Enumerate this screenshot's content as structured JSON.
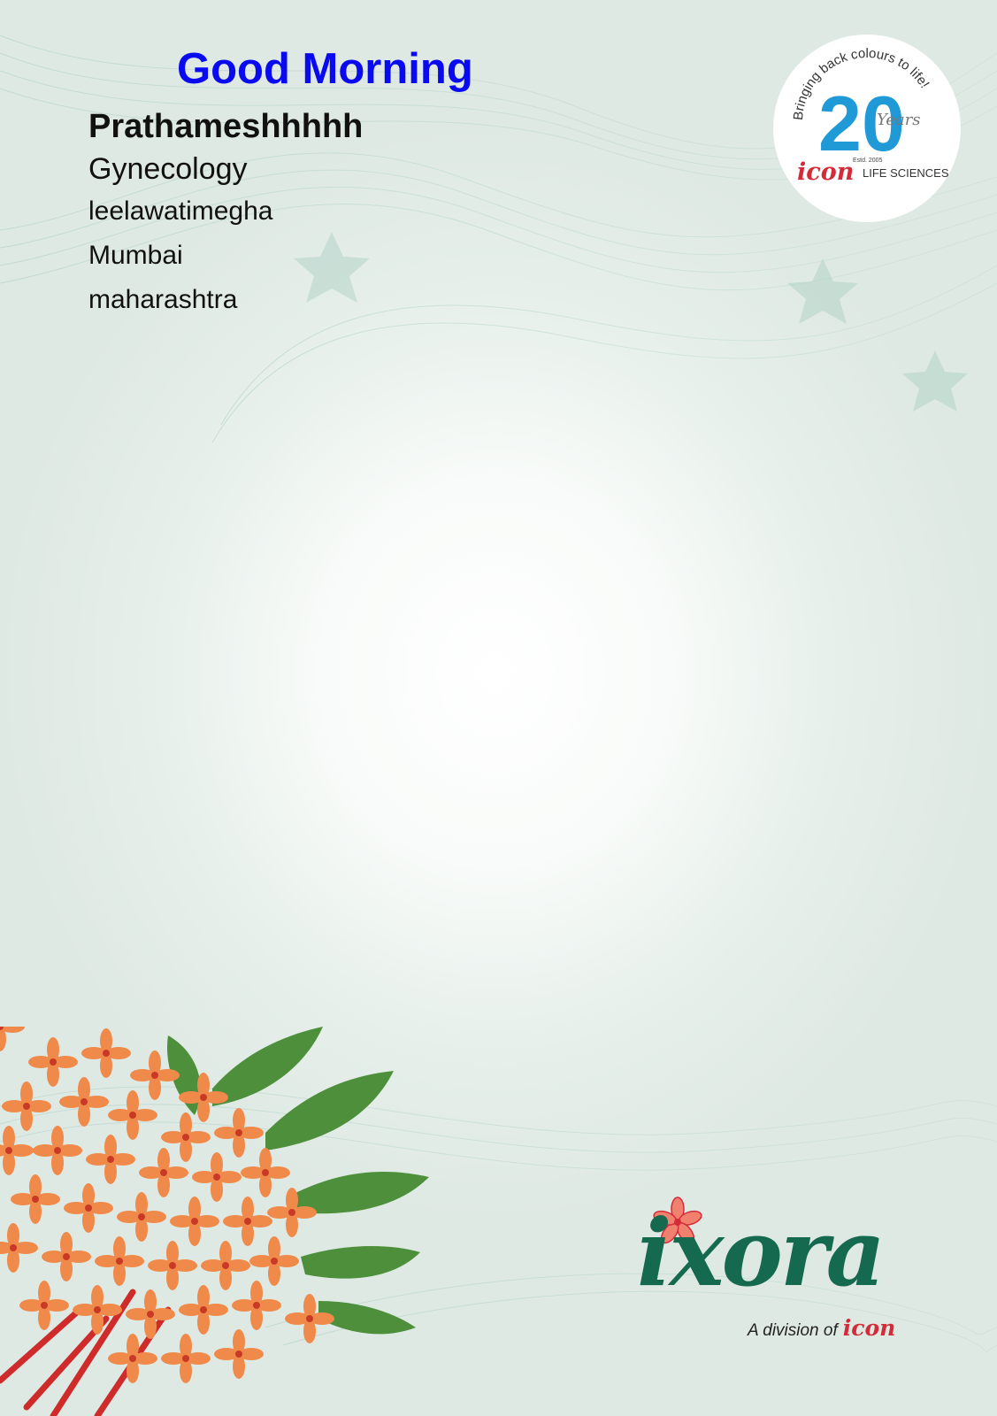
{
  "greeting": "Good Morning",
  "doctor": {
    "name": "Prathameshhhhh",
    "specialty": "Gynecology",
    "clinic": "leelawatimegha",
    "city": "Mumbai",
    "state": "maharashtra"
  },
  "badge": {
    "tagline": "Bringing back colours to life!",
    "number": "20",
    "years": "Years",
    "established": "Estd. 2005",
    "brand": "icon",
    "brand_suffix": "LIFE SCIENCES"
  },
  "brand": {
    "name": "ixora",
    "tagline": "A division of",
    "parent": "icon"
  },
  "colors": {
    "greeting": "#0a0af0",
    "specialty": "#6b6b6b",
    "badge_blue": "#1f9ad6",
    "icon_red": "#d42b39",
    "ixora_green": "#14694f",
    "flower_orange": "#f08a4b"
  }
}
